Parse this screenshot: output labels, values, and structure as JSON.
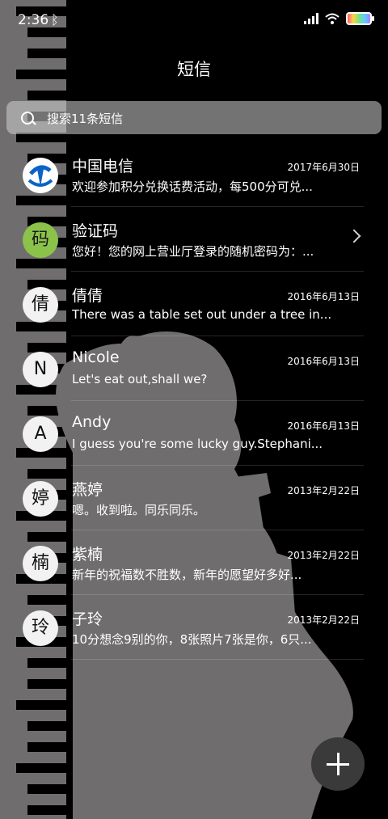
{
  "status_bar": {
    "time": "2:36"
  },
  "header": {
    "title": "短信"
  },
  "search": {
    "placeholder": "搜索11条短信"
  },
  "conversations": [
    {
      "avatar": "",
      "avatar_type": "telecom-logo",
      "name": "中国电信",
      "date": "2017年6月30日",
      "preview": "欢迎参加积分兑换话费活动，每500分可兑..."
    },
    {
      "avatar": "码",
      "avatar_type": "green",
      "name": "验证码",
      "date": "",
      "preview": "您好！您的网上营业厅登录的随机密码为：..."
    },
    {
      "avatar": "倩",
      "avatar_type": "letter",
      "name": "倩倩",
      "date": "2016年6月13日",
      "preview": "There was a table set out under a tree in..."
    },
    {
      "avatar": "N",
      "avatar_type": "letter",
      "name": "Nicole",
      "date": "2016年6月13日",
      "preview": "Let's eat out,shall we?"
    },
    {
      "avatar": "A",
      "avatar_type": "letter",
      "name": "Andy",
      "date": "2016年6月13日",
      "preview": "I guess you're some lucky guy.Stephani..."
    },
    {
      "avatar": "婷",
      "avatar_type": "letter",
      "name": "燕婷",
      "date": "2013年2月22日",
      "preview": "嗯。收到啦。同乐同乐。"
    },
    {
      "avatar": "楠",
      "avatar_type": "letter",
      "name": "紫楠",
      "date": "2013年2月22日",
      "preview": "新年的祝福数不胜数，新年的愿望好多好..."
    },
    {
      "avatar": "玲",
      "avatar_type": "letter",
      "name": "子玲",
      "date": "2013年2月22日",
      "preview": "10分想念9别的你，8张照片7张是你，6只..."
    }
  ],
  "fab": {
    "icon": "plus-icon"
  }
}
